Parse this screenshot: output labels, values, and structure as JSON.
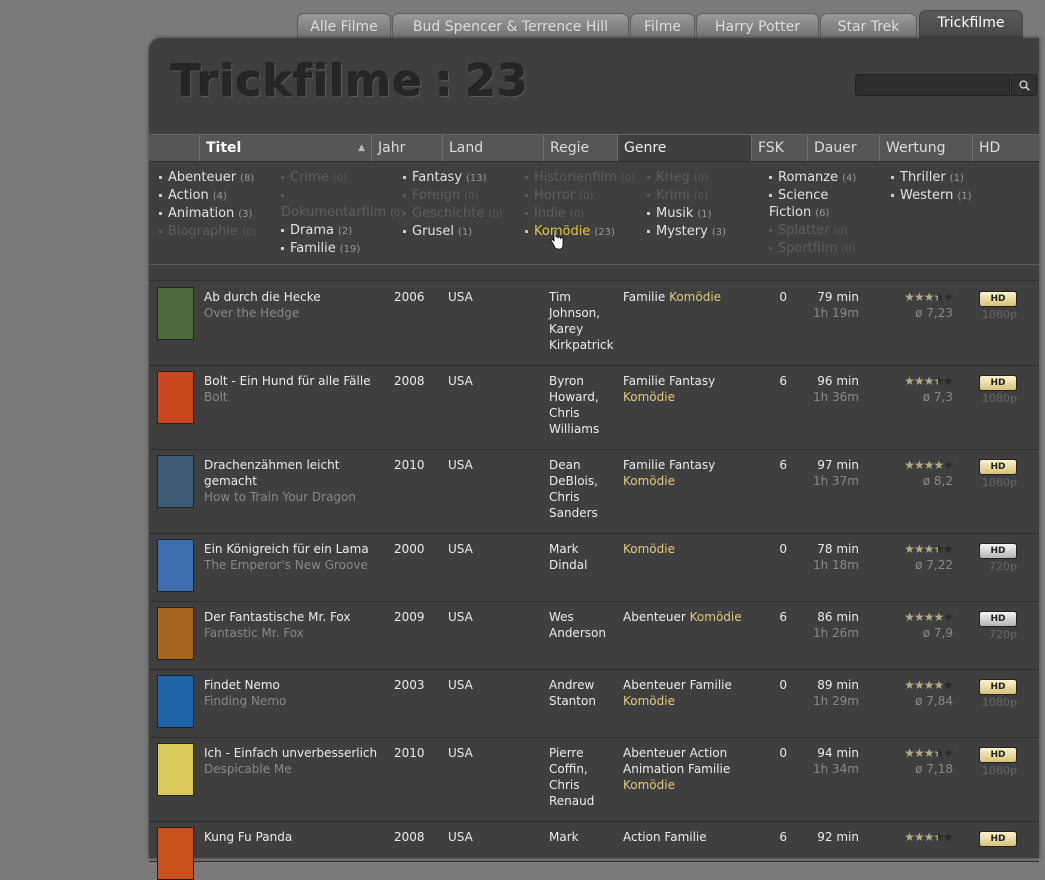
{
  "tabs": [
    "Alle Filme",
    "Bud Spencer & Terrence Hill",
    "Filme",
    "Harry Potter",
    "Star Trek",
    "Trickfilme"
  ],
  "page": {
    "title": "Trickfilme",
    "separator": ":",
    "count": "23"
  },
  "search": {
    "value": "",
    "placeholder": ""
  },
  "columns": [
    {
      "label": "Titel",
      "sorted": true,
      "sort_dir": "asc"
    },
    {
      "label": "Jahr"
    },
    {
      "label": "Land"
    },
    {
      "label": "Regie"
    },
    {
      "label": "Genre",
      "active": true
    },
    {
      "label": "FSK"
    },
    {
      "label": "Dauer"
    },
    {
      "label": "Wertung"
    },
    {
      "label": "HD"
    }
  ],
  "filters": [
    [
      {
        "label": "Abenteuer",
        "count": "(8)",
        "state": "on"
      },
      {
        "label": "Action",
        "count": "(4)",
        "state": "on"
      },
      {
        "label": "Animation",
        "count": "(3)",
        "state": "on"
      },
      {
        "label": "Biographie",
        "count": "(0)",
        "state": "off"
      }
    ],
    [
      {
        "label": "Crime",
        "count": "(0)",
        "state": "off"
      },
      {
        "label": "Dokumentarfilm",
        "count": "(0)",
        "state": "off"
      },
      {
        "label": "Drama",
        "count": "(2)",
        "state": "on"
      },
      {
        "label": "Familie",
        "count": "(19)",
        "state": "on"
      }
    ],
    [
      {
        "label": "Fantasy",
        "count": "(13)",
        "state": "on"
      },
      {
        "label": "Foreign",
        "count": "(0)",
        "state": "off"
      },
      {
        "label": "Geschichte",
        "count": "(0)",
        "state": "off"
      },
      {
        "label": "Grusel",
        "count": "(1)",
        "state": "on"
      }
    ],
    [
      {
        "label": "Historienfilm",
        "count": "(0)",
        "state": "off"
      },
      {
        "label": "Horror",
        "count": "(0)",
        "state": "off"
      },
      {
        "label": "Indie",
        "count": "(0)",
        "state": "off"
      },
      {
        "label": "Komödie",
        "count": "(23)",
        "state": "selected"
      }
    ],
    [
      {
        "label": "Krieg",
        "count": "(0)",
        "state": "off"
      },
      {
        "label": "Krimi",
        "count": "(0)",
        "state": "off"
      },
      {
        "label": "Musik",
        "count": "(1)",
        "state": "on"
      },
      {
        "label": "Mystery",
        "count": "(3)",
        "state": "on"
      }
    ],
    [
      {
        "label": "Romanze",
        "count": "(4)",
        "state": "on"
      },
      {
        "label": "Science Fiction",
        "count": "(6)",
        "state": "on"
      },
      {
        "label": "Splatter",
        "count": "(0)",
        "state": "off"
      },
      {
        "label": "Sportfilm",
        "count": "(0)",
        "state": "off"
      }
    ],
    [
      {
        "label": "Thriller",
        "count": "(1)",
        "state": "on"
      },
      {
        "label": "Western",
        "count": "(1)",
        "state": "on"
      }
    ]
  ],
  "movies": [
    {
      "title": "Ab durch die Hecke",
      "original": "Over the Hedge",
      "year": "2006",
      "country": "USA",
      "director": [
        "Tim",
        "Johnson,",
        "Karey",
        "Kirkpatrick"
      ],
      "genres": [
        [
          "Familie",
          false
        ],
        [
          "Komödie",
          true
        ]
      ],
      "fsk": "0",
      "duration": "79 min",
      "duration_h": "1h 19m",
      "rating": "ø 7,23",
      "stars": 3.5,
      "hd": "HD",
      "hd_style": "gold",
      "resolution": "1080p",
      "poster_color": "#4b6a3a"
    },
    {
      "title": "Bolt - Ein Hund für alle Fälle",
      "original": "Bolt",
      "year": "2008",
      "country": "USA",
      "director": [
        "Byron",
        "Howard,",
        "Chris",
        "Williams"
      ],
      "genres": [
        [
          "Familie",
          false
        ],
        [
          "Fantasy",
          false
        ],
        [
          "Komödie",
          true
        ]
      ],
      "fsk": "6",
      "duration": "96 min",
      "duration_h": "1h 36m",
      "rating": "ø 7,3",
      "stars": 3.5,
      "hd": "HD",
      "hd_style": "gold",
      "resolution": "1080p",
      "poster_color": "#c8471e"
    },
    {
      "title": "Drachenzähmen leicht gemacht",
      "original": "How to Train Your Dragon",
      "year": "2010",
      "country": "USA",
      "director": [
        "Dean",
        "DeBlois,",
        "Chris",
        "Sanders"
      ],
      "genres": [
        [
          "Familie",
          false
        ],
        [
          "Fantasy",
          false
        ],
        [
          "Komödie",
          true
        ]
      ],
      "fsk": "6",
      "duration": "97 min",
      "duration_h": "1h 37m",
      "rating": "ø 8,2",
      "stars": 4,
      "hd": "HD",
      "hd_style": "gold",
      "resolution": "1080p",
      "poster_color": "#3e5a75"
    },
    {
      "title": "Ein Königreich für ein Lama",
      "original": "The Emperor's New Groove",
      "year": "2000",
      "country": "USA",
      "director": [
        "Mark",
        "Dindal"
      ],
      "genres": [
        [
          "Komödie",
          true
        ]
      ],
      "fsk": "0",
      "duration": "78 min",
      "duration_h": "1h 18m",
      "rating": "ø 7,22",
      "stars": 3.5,
      "hd": "HD",
      "hd_style": "silver",
      "resolution": "720p",
      "poster_color": "#3d6fae"
    },
    {
      "title": "Der Fantastische Mr. Fox",
      "original": "Fantastic Mr. Fox",
      "year": "2009",
      "country": "USA",
      "director": [
        "Wes",
        "Anderson"
      ],
      "genres": [
        [
          "Abenteuer",
          false
        ],
        [
          "Komödie",
          true
        ]
      ],
      "fsk": "6",
      "duration": "86 min",
      "duration_h": "1h 26m",
      "rating": "ø 7,9",
      "stars": 4,
      "hd": "HD",
      "hd_style": "silver",
      "resolution": "720p",
      "poster_color": "#a5641f"
    },
    {
      "title": "Findet Nemo",
      "original": "Finding Nemo",
      "year": "2003",
      "country": "USA",
      "director": [
        "Andrew",
        "Stanton"
      ],
      "genres": [
        [
          "Abenteuer",
          false
        ],
        [
          "Familie",
          false
        ],
        [
          "Komödie",
          true
        ]
      ],
      "fsk": "0",
      "duration": "89 min",
      "duration_h": "1h 29m",
      "rating": "ø 7,84",
      "stars": 4,
      "hd": "HD",
      "hd_style": "gold",
      "resolution": "1080p",
      "poster_color": "#1f64a8"
    },
    {
      "title": "Ich - Einfach unverbesserlich",
      "original": "Despicable Me",
      "year": "2010",
      "country": "USA",
      "director": [
        "Pierre",
        "Coffin,",
        "Chris",
        "Renaud"
      ],
      "genres": [
        [
          "Abenteuer",
          false
        ],
        [
          "Action",
          false
        ],
        [
          "Animation",
          false
        ],
        [
          "Familie",
          false
        ],
        [
          "Komödie",
          true
        ]
      ],
      "fsk": "0",
      "duration": "94 min",
      "duration_h": "1h 34m",
      "rating": "ø 7,18",
      "stars": 3.5,
      "hd": "HD",
      "hd_style": "gold",
      "resolution": "1080p",
      "poster_color": "#d9c95a"
    },
    {
      "title": "Kung Fu Panda",
      "original": "",
      "year": "2008",
      "country": "USA",
      "director": [
        "Mark"
      ],
      "genres": [
        [
          "Action",
          false
        ],
        [
          "Familie",
          false
        ]
      ],
      "fsk": "6",
      "duration": "92 min",
      "duration_h": "",
      "rating": "",
      "stars": 3.5,
      "hd": "HD",
      "hd_style": "gold",
      "resolution": "",
      "poster_color": "#c9511c"
    }
  ]
}
